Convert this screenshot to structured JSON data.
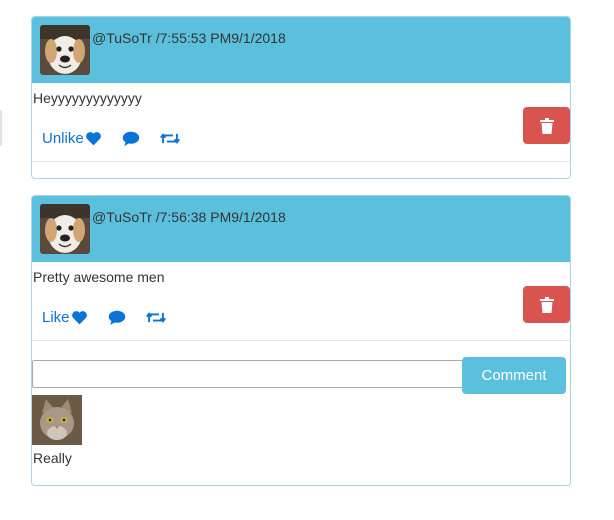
{
  "posts": [
    {
      "meta": "@TuSoTr /7:55:53 PM9/1/2018",
      "text": "Heyyyyyyyyyyyyy",
      "like_label": "Unlike",
      "avatar": "dog-avatar"
    },
    {
      "meta": "@TuSoTr /7:56:38 PM9/1/2018",
      "text": "Pretty awesome men",
      "like_label": "Like",
      "avatar": "dog-avatar",
      "comment_input": {
        "value": "",
        "placeholder": ""
      },
      "comment_button": "Comment",
      "comments": [
        {
          "avatar": "cat-avatar",
          "text": "Really"
        }
      ]
    }
  ],
  "colors": {
    "header": "#5bc0de",
    "link": "#0a73d6",
    "danger": "#d9534f",
    "border": "#a9d5e5"
  },
  "icons": [
    "heart-icon",
    "comment-icon",
    "retweet-icon",
    "trash-icon"
  ]
}
